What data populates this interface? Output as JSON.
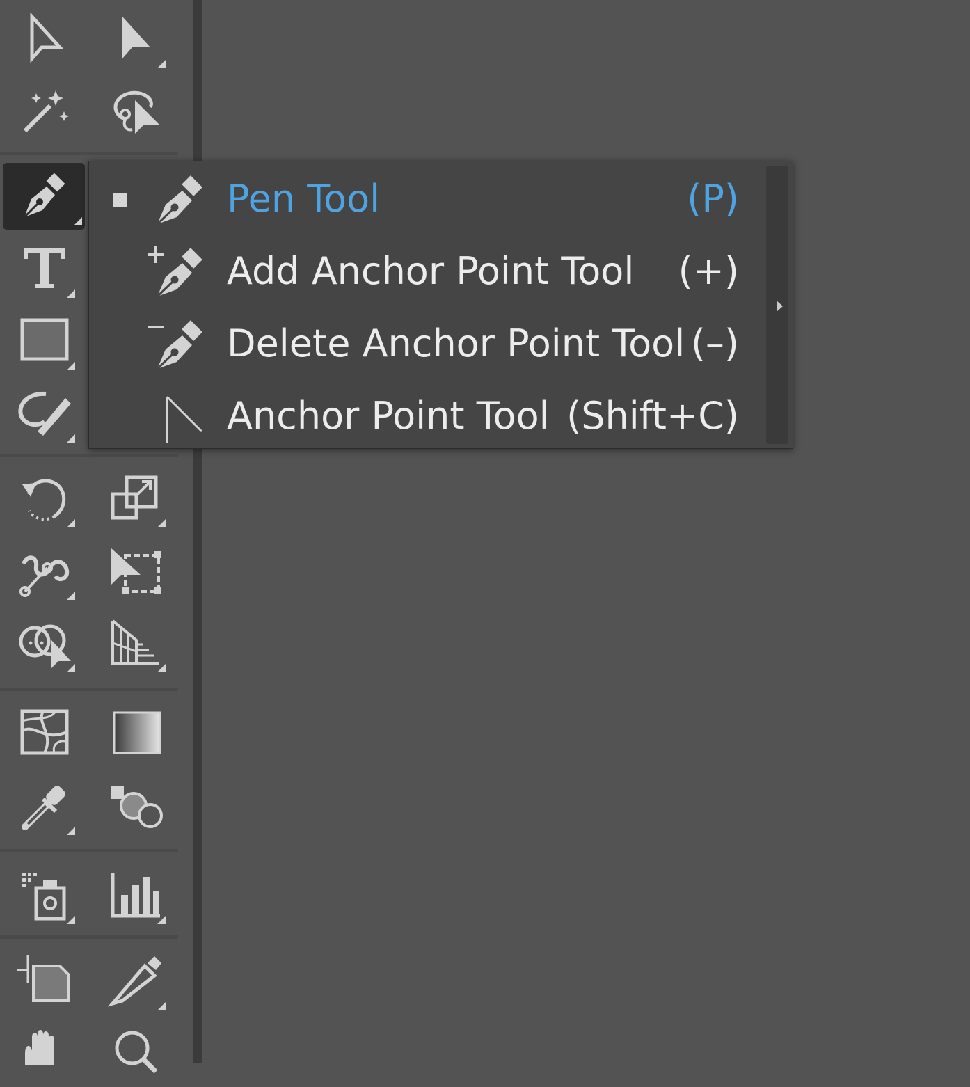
{
  "toolbar": {
    "tools": [
      {
        "name": "selection-tool",
        "icon": "selection-arrow-icon"
      },
      {
        "name": "direct-selection-tool",
        "icon": "direct-selection-arrow-icon"
      },
      {
        "name": "magic-wand-tool",
        "icon": "magic-wand-icon"
      },
      {
        "name": "lasso-tool",
        "icon": "lasso-icon"
      },
      {
        "name": "pen-tool",
        "icon": "pen-icon",
        "active": true
      },
      {
        "name": "type-tool",
        "icon": "type-icon"
      },
      {
        "name": "rectangle-tool",
        "icon": "rectangle-icon"
      },
      {
        "name": "shaper-tool",
        "icon": "shaper-icon"
      },
      {
        "name": "rotate-tool",
        "icon": "rotate-icon"
      },
      {
        "name": "scale-tool",
        "icon": "scale-icon"
      },
      {
        "name": "puppet-warp-tool",
        "icon": "puppet-warp-icon"
      },
      {
        "name": "free-transform-tool",
        "icon": "free-transform-icon"
      },
      {
        "name": "shape-builder-tool",
        "icon": "shape-builder-icon"
      },
      {
        "name": "perspective-grid-tool",
        "icon": "perspective-grid-icon"
      },
      {
        "name": "mesh-tool",
        "icon": "mesh-icon"
      },
      {
        "name": "gradient-tool",
        "icon": "gradient-icon"
      },
      {
        "name": "eyedropper-tool",
        "icon": "eyedropper-icon"
      },
      {
        "name": "blend-tool",
        "icon": "blend-icon"
      },
      {
        "name": "symbol-sprayer-tool",
        "icon": "symbol-sprayer-icon"
      },
      {
        "name": "column-graph-tool",
        "icon": "column-graph-icon"
      },
      {
        "name": "artboard-tool",
        "icon": "artboard-icon"
      },
      {
        "name": "slice-tool",
        "icon": "slice-icon"
      },
      {
        "name": "hand-tool",
        "icon": "hand-icon"
      },
      {
        "name": "zoom-tool",
        "icon": "zoom-icon"
      }
    ]
  },
  "flyout": {
    "items": [
      {
        "label": "Pen Tool",
        "shortcut": "(P)",
        "icon": "pen-icon",
        "selected": true
      },
      {
        "label": "Add Anchor Point Tool",
        "shortcut": "(+)",
        "icon": "add-anchor-point-icon"
      },
      {
        "label": "Delete Anchor Point Tool",
        "shortcut": "(–)",
        "icon": "delete-anchor-point-icon"
      },
      {
        "label": "Anchor Point Tool",
        "shortcut": "(Shift+C)",
        "icon": "anchor-point-icon"
      }
    ],
    "tearoff_icon": "tearoff-arrow-icon"
  },
  "colors": {
    "background": "#535353",
    "toolbar_edge": "#3b3b3b",
    "flyout_bg": "#454545",
    "selected_text": "#4fa3e0",
    "text": "#ececec",
    "icon": "#d3d3d3"
  }
}
